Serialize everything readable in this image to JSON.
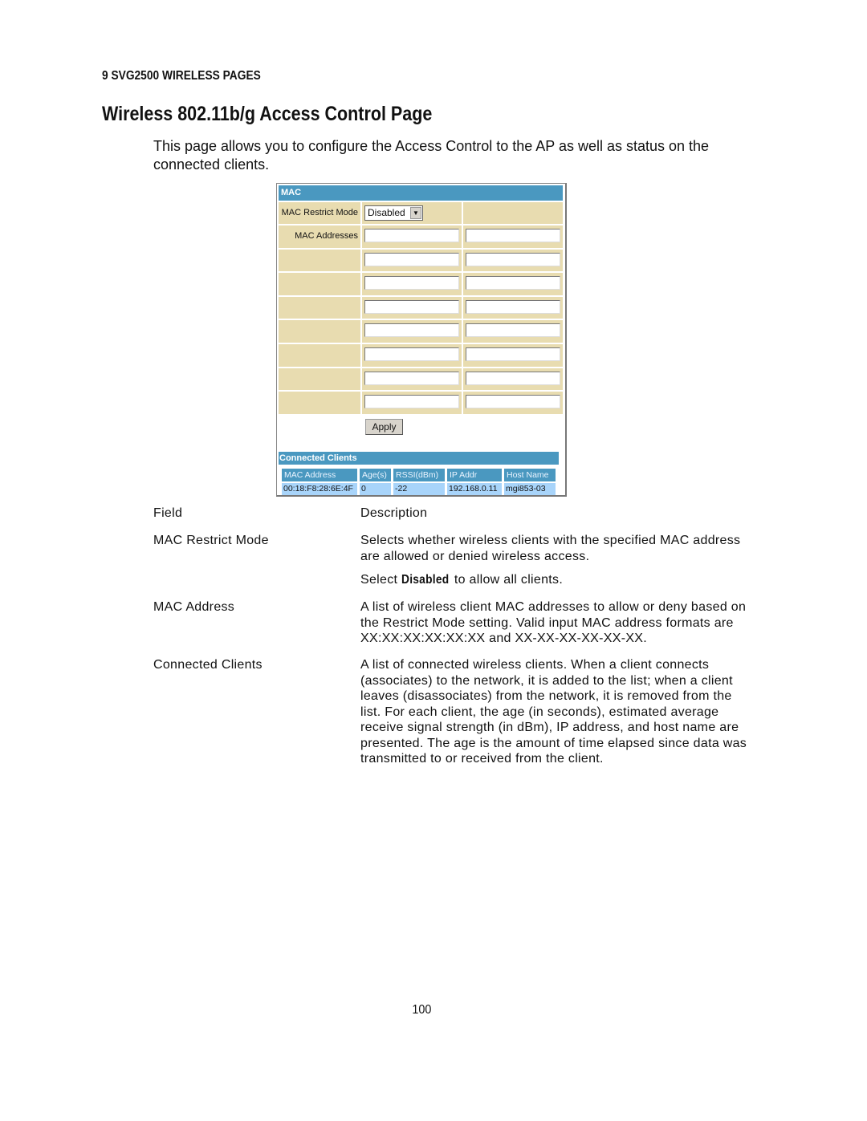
{
  "section_header": "9 SVG2500 WIRELESS PAGES",
  "title": "Wireless 802.11b/g Access Control Page",
  "intro": "This page allows you to configure the Access Control to the AP as well as status on the connected clients.",
  "ui": {
    "mac_header": "MAC",
    "restrict_label": "MAC Restrict Mode",
    "restrict_value": "Disabled",
    "addresses_label": "MAC Addresses",
    "apply": "Apply",
    "clients_header": "Connected Clients",
    "columns": [
      "MAC Address",
      "Age(s)",
      "RSSI(dBm)",
      "IP Addr",
      "Host Name"
    ],
    "rows": [
      [
        "00:18:F8:28:6E:4F",
        "0",
        "-22",
        "192.168.0.11",
        "mgi853-03"
      ]
    ],
    "colors": {
      "header": "#4a98c0",
      "cell": "#e8dcb0",
      "row": "#a8d4fa"
    }
  },
  "fields": {
    "head_field": "Field",
    "head_desc": "Description",
    "items": [
      {
        "field": "MAC Restrict Mode",
        "desc": "Selects whether wireless clients with the specified MAC address are allowed or denied wireless access.",
        "desc2_pre": "Select ",
        "desc2_bold": "Disabled",
        "desc2_post": " to allow all clients."
      },
      {
        "field": "MAC Address",
        "desc": "A list of wireless client MAC addresses to allow or deny based on the Restrict Mode setting. Valid input MAC address formats are XX:XX:XX:XX:XX:XX and XX-XX-XX-XX-XX-XX."
      },
      {
        "field": "Connected Clients",
        "desc": "A list of connected wireless clients. When a client connects (associates) to the network, it is added to the list; when a client leaves (disassociates) from the network, it is removed from the list. For each client, the age (in seconds), estimated average receive signal strength (in dBm), IP address, and host name are presented. The age is the amount of time elapsed since data was transmitted to or received from the client."
      }
    ]
  },
  "page_number": "100"
}
